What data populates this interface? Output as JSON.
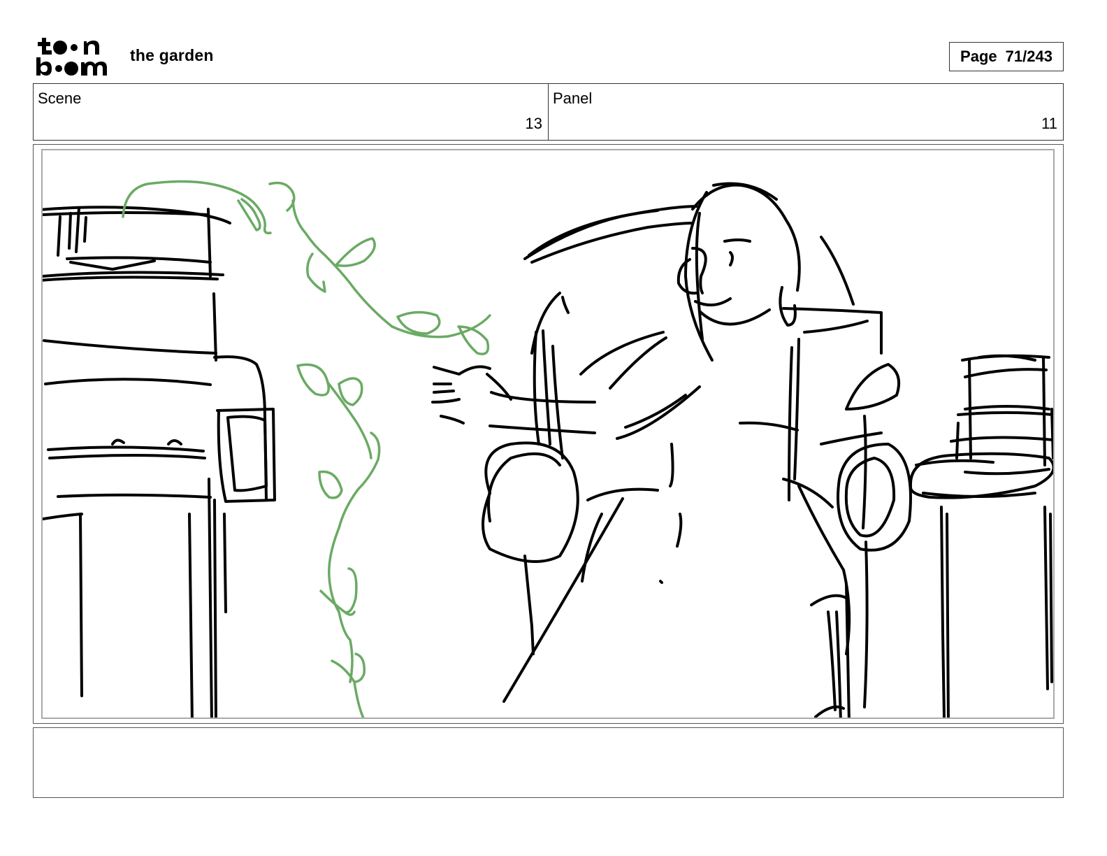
{
  "header": {
    "logo_text": "toon boom",
    "project_title": "the garden",
    "page_label": "Page",
    "page_number": "71/243"
  },
  "fields": {
    "scene_label": "Scene",
    "scene_value": "13",
    "panel_label": "Panel",
    "panel_value": "11"
  },
  "colors": {
    "sketch_ink": "#000000",
    "vine_green": "#6aaa64"
  },
  "notes": ""
}
